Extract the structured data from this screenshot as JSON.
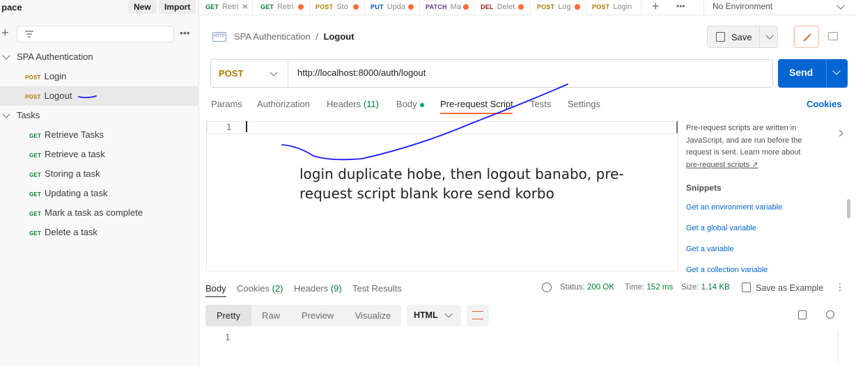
{
  "sidebar": {
    "title": "pace",
    "new_label": "New",
    "import_label": "Import",
    "collection": "SPA Authentication",
    "collection_items": [
      {
        "method": "POST",
        "name": "Login"
      },
      {
        "method": "POST",
        "name": "Logout"
      }
    ],
    "folder": "Tasks",
    "folder_items": [
      {
        "method": "GET",
        "name": "Retrieve Tasks"
      },
      {
        "method": "GET",
        "name": "Retrieve a task"
      },
      {
        "method": "GET",
        "name": "Storing a task"
      },
      {
        "method": "GET",
        "name": "Updating a task"
      },
      {
        "method": "GET",
        "name": "Mark a task as complete"
      },
      {
        "method": "GET",
        "name": "Delete a task"
      }
    ]
  },
  "tabs": [
    {
      "method": "GET",
      "name": "Retri"
    },
    {
      "method": "GET",
      "name": "Retri"
    },
    {
      "method": "POST",
      "name": "Sto"
    },
    {
      "method": "PUT",
      "name": "Upda"
    },
    {
      "method": "PATCH",
      "name": "Ma"
    },
    {
      "method": "DEL",
      "name": "Delet"
    },
    {
      "method": "POST",
      "name": "Log"
    },
    {
      "method": "POST",
      "name": "Login"
    }
  ],
  "environment": "No Environment",
  "breadcrumb": {
    "icon": "HTTP",
    "parent": "SPA Authentication",
    "separator": "/",
    "current": "Logout"
  },
  "save_label": "Save",
  "request": {
    "method": "POST",
    "url": "http://localhost:8000/auth/logout",
    "send_label": "Send"
  },
  "request_tabs": {
    "params": "Params",
    "authorization": "Authorization",
    "headers": "Headers",
    "headers_count": "(11)",
    "body": "Body",
    "prerequest": "Pre-request Script",
    "tests": "Tests",
    "settings": "Settings",
    "cookies": "Cookies"
  },
  "editor": {
    "line_number": "1"
  },
  "annotation_text": "login duplicate hobe, then logout banabo, pre-request script blank kore send korbo",
  "help": {
    "text": "Pre-request scripts are written in JavaScript, and are run before the request is sent. Learn more about",
    "link": "pre-request scripts ↗",
    "snippets_title": "Snippets",
    "snippets": [
      "Get an environment variable",
      "Get a global variable",
      "Get a variable",
      "Get a collection variable"
    ]
  },
  "response": {
    "tabs": {
      "body": "Body",
      "cookies": "Cookies",
      "cookies_count": "(2)",
      "headers": "Headers",
      "headers_count": "(9)",
      "tests": "Test Results"
    },
    "status_label": "Status:",
    "status_value": "200 OK",
    "time_label": "Time:",
    "time_value": "152 ms",
    "size_label": "Size:",
    "size_value": "1.14 KB",
    "save_example": "Save as Example",
    "views": [
      "Pretty",
      "Raw",
      "Preview",
      "Visualize"
    ],
    "format": "HTML",
    "line_number": "1"
  },
  "colors": {
    "accent": "#ff6c37",
    "send": "#0265d2",
    "get": "#007f31",
    "post": "#ad7a03",
    "annotation": "#0000ee"
  }
}
